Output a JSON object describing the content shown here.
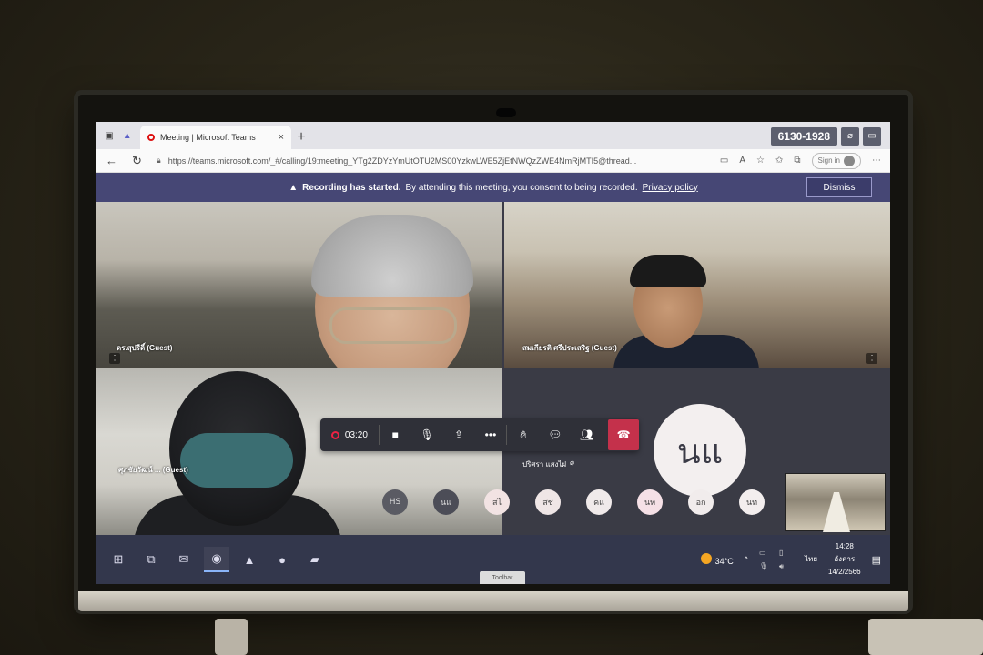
{
  "browser": {
    "tab_title": "Meeting | Microsoft Teams",
    "tab_close": "×",
    "new_tab": "+",
    "url": "https://teams.microsoft.com/_#/calling/19:meeting_YTg2ZDYzYmUtOTU2MS00YzkwLWE5ZjEtNWQzZWE4NmRjMTI5@thread...",
    "sign_in": "Sign in"
  },
  "overlay": {
    "room_number": "6130-1928"
  },
  "banner": {
    "bold_text": "Recording has started.",
    "text": "By attending this meeting, you consent to being recorded.",
    "link": "Privacy policy",
    "dismiss": "Dismiss"
  },
  "participants": {
    "tile1_name": "ดร.สุปรีดิ์ (Guest)",
    "tile2_name": "สมเกียรติ ศรีประเสริฐ (Guest)",
    "tile3_name": "ศุภชัยวัฒน์ ... (Guest)",
    "tile4_name": "ปริศรา แสงไฝ",
    "big_avatar": "นแ",
    "avatar_row": [
      "HS",
      "นแ",
      "สไ",
      "สช",
      "คแ",
      "นท",
      "อก",
      "นท"
    ]
  },
  "controls": {
    "timer": "03:20"
  },
  "taskbar": {
    "temperature": "34°C",
    "language": "ไทย",
    "time": "14:28",
    "day": "อังคาร",
    "date": "14/2/2566",
    "toolbar_tag": "Toolbar"
  },
  "colors": {
    "teams_banner": "#464775",
    "hangup": "#c4314b",
    "taskbar": "#33374c"
  }
}
